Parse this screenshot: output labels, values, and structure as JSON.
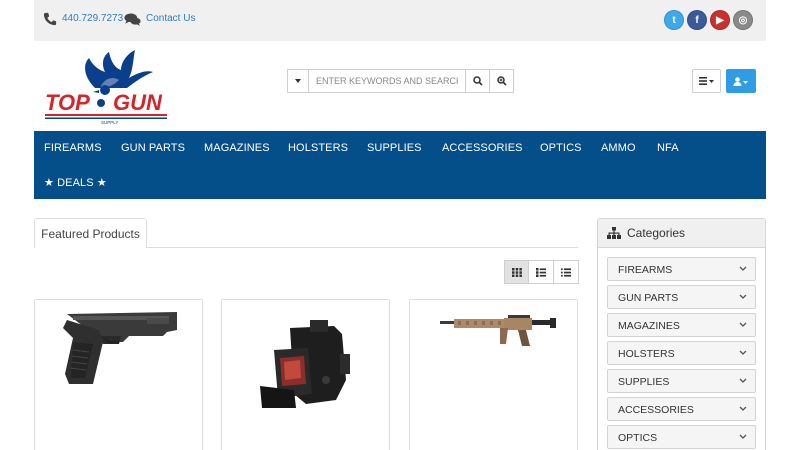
{
  "topbar": {
    "phone": "440.729.7273",
    "contact": "Contact Us",
    "social": [
      {
        "label": "t",
        "icon": "twitter-icon"
      },
      {
        "label": "f",
        "icon": "facebook-icon"
      },
      {
        "label": "▶",
        "icon": "youtube-icon"
      },
      {
        "label": "◎",
        "icon": "instagram-icon"
      }
    ]
  },
  "logo": {
    "text": "TOP GUN",
    "sub": "SUPPLY",
    "colors": {
      "red": "#d4252a",
      "blue": "#0b3f8c"
    }
  },
  "search": {
    "placeholder": "ENTER KEYWORDS AND SEARCH"
  },
  "nav": {
    "items": [
      "FIREARMS",
      "GUN PARTS",
      "MAGAZINES",
      "HOLSTERS",
      "SUPPLIES",
      "ACCESSORIES",
      "OPTICS",
      "AMMO",
      "NFA"
    ],
    "deals": "★ DEALS ★"
  },
  "featured": {
    "tab": "Featured Products"
  },
  "categories": {
    "title": "Categories",
    "items": [
      "FIREARMS",
      "GUN PARTS",
      "MAGAZINES",
      "HOLSTERS",
      "SUPPLIES",
      "ACCESSORIES",
      "OPTICS"
    ]
  },
  "colors": {
    "nav_bg": "#044f8a",
    "link": "#2a7fc0",
    "accent": "#2f9de6"
  }
}
